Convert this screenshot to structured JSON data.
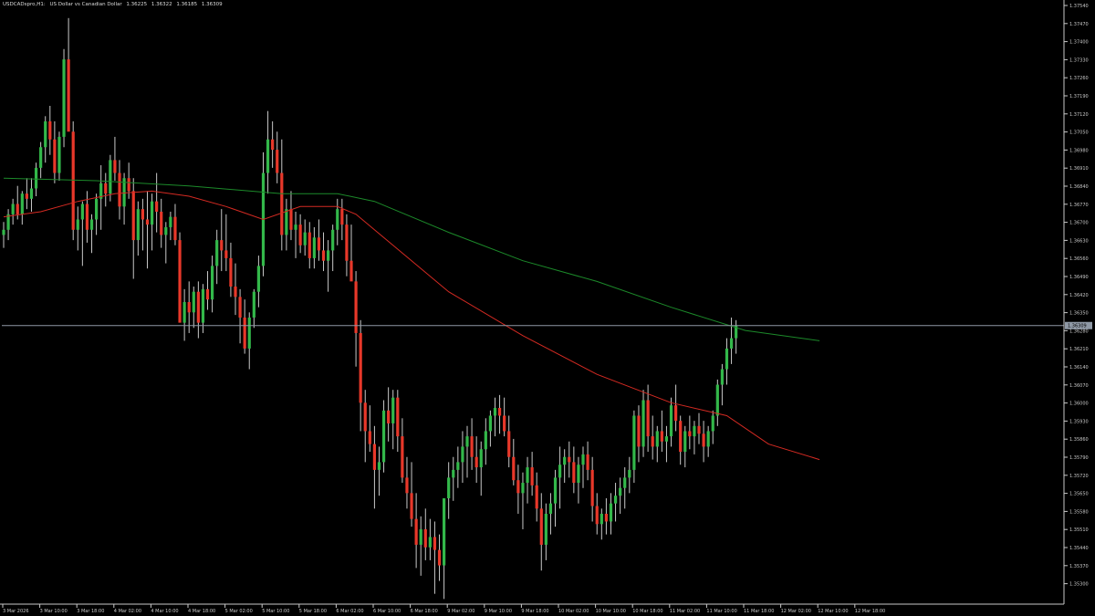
{
  "header": {
    "symbol": "USDCADspro,H1:",
    "description": "US Dollar vs Canadian Dollar",
    "ohlc": [
      "1.36225",
      "1.36322",
      "1.36185",
      "1.36309"
    ]
  },
  "colors": {
    "background": "#000000",
    "bull_candle": "#33b84a",
    "bear_candle": "#e8382a",
    "wick": "#c8c8c8",
    "ma_fast": "#d42a22",
    "ma_slow": "#1c8a2a",
    "price_line": "#8f99a6",
    "axis": "#c8c8c8"
  },
  "current_price": {
    "label": "1.36309",
    "value": 1.36309
  },
  "chart_data": {
    "type": "candlestick",
    "title": "USDCADspro,H1: US Dollar vs Canadian Dollar",
    "ylim": [
      1.3523,
      1.3757
    ],
    "y_ticks": [
      "1.37540",
      "1.37470",
      "1.37400",
      "1.37330",
      "1.37260",
      "1.37190",
      "1.37120",
      "1.37050",
      "1.36980",
      "1.36910",
      "1.36840",
      "1.36770",
      "1.36700",
      "1.36630",
      "1.36560",
      "1.36490",
      "1.36420",
      "1.36350",
      "1.36280",
      "1.36210",
      "1.36140",
      "1.36070",
      "1.36000",
      "1.35930",
      "1.35860",
      "1.35790",
      "1.35720",
      "1.35650",
      "1.35580",
      "1.35510",
      "1.35440",
      "1.35370",
      "1.35300"
    ],
    "x_ticks": [
      "3 Mar 2026",
      "3 Mar 10:00",
      "3 Mar 18:00",
      "4 Mar 02:00",
      "4 Mar 10:00",
      "4 Mar 18:00",
      "5 Mar 02:00",
      "5 Mar 10:00",
      "5 Mar 18:00",
      "6 Mar 02:00",
      "6 Mar 10:00",
      "6 Mar 18:00",
      "9 Mar 02:00",
      "9 Mar 10:00",
      "9 Mar 18:00",
      "10 Mar 02:00",
      "10 Mar 10:00",
      "10 Mar 18:00",
      "11 Mar 02:00",
      "11 Mar 10:00",
      "11 Mar 18:00",
      "12 Mar 02:00",
      "12 Mar 10:00",
      "12 Mar 18:00"
    ],
    "candles": [
      [
        1.3666,
        1.3671,
        1.3661,
        1.3668
      ],
      [
        1.3668,
        1.3676,
        1.3664,
        1.3674
      ],
      [
        1.3674,
        1.368,
        1.367,
        1.3678
      ],
      [
        1.3678,
        1.3685,
        1.3672,
        1.3674
      ],
      [
        1.3674,
        1.3683,
        1.367,
        1.3682
      ],
      [
        1.3682,
        1.3688,
        1.3676,
        1.368
      ],
      [
        1.368,
        1.3688,
        1.3675,
        1.3684
      ],
      [
        1.3684,
        1.3694,
        1.3681,
        1.3692
      ],
      [
        1.3692,
        1.3702,
        1.3688,
        1.37
      ],
      [
        1.37,
        1.3712,
        1.3694,
        1.371
      ],
      [
        1.371,
        1.3716,
        1.3697,
        1.3703
      ],
      [
        1.3703,
        1.371,
        1.3686,
        1.369
      ],
      [
        1.369,
        1.3706,
        1.3687,
        1.3704
      ],
      [
        1.3704,
        1.3738,
        1.37,
        1.3734
      ],
      [
        1.3734,
        1.375,
        1.3712,
        1.3706
      ],
      [
        1.3706,
        1.371,
        1.3664,
        1.3668
      ],
      [
        1.3668,
        1.3677,
        1.366,
        1.3672
      ],
      [
        1.3672,
        1.3679,
        1.3654,
        1.3678
      ],
      [
        1.3678,
        1.3683,
        1.3663,
        1.3668
      ],
      [
        1.3668,
        1.3674,
        1.3659,
        1.3672
      ],
      [
        1.3672,
        1.3682,
        1.3666,
        1.368
      ],
      [
        1.368,
        1.3693,
        1.3668,
        1.3686
      ],
      [
        1.3686,
        1.369,
        1.3677,
        1.3682
      ],
      [
        1.3682,
        1.3697,
        1.3679,
        1.3695
      ],
      [
        1.3695,
        1.3704,
        1.3687,
        1.369
      ],
      [
        1.369,
        1.3695,
        1.3672,
        1.3677
      ],
      [
        1.3677,
        1.369,
        1.367,
        1.3688
      ],
      [
        1.3688,
        1.3694,
        1.368,
        1.3683
      ],
      [
        1.3683,
        1.3688,
        1.3649,
        1.3664
      ],
      [
        1.3664,
        1.3679,
        1.3658,
        1.3676
      ],
      [
        1.3676,
        1.368,
        1.366,
        1.3672
      ],
      [
        1.3672,
        1.3683,
        1.3653,
        1.367
      ],
      [
        1.367,
        1.3682,
        1.366,
        1.3679
      ],
      [
        1.3679,
        1.369,
        1.3667,
        1.3675
      ],
      [
        1.3675,
        1.368,
        1.3661,
        1.3666
      ],
      [
        1.3666,
        1.3671,
        1.3655,
        1.3669
      ],
      [
        1.3669,
        1.3675,
        1.3664,
        1.3673
      ],
      [
        1.3673,
        1.3678,
        1.3662,
        1.3664
      ],
      [
        1.3664,
        1.3667,
        1.3643,
        1.3632
      ],
      [
        1.3632,
        1.3645,
        1.3625,
        1.364
      ],
      [
        1.364,
        1.3648,
        1.3628,
        1.3636
      ],
      [
        1.3636,
        1.3646,
        1.363,
        1.3644
      ],
      [
        1.3644,
        1.3648,
        1.3626,
        1.3632
      ],
      [
        1.3632,
        1.3647,
        1.3628,
        1.3645
      ],
      [
        1.3645,
        1.3652,
        1.3637,
        1.3641
      ],
      [
        1.3641,
        1.3658,
        1.3636,
        1.3654
      ],
      [
        1.3654,
        1.3668,
        1.3647,
        1.3664
      ],
      [
        1.3664,
        1.3676,
        1.3652,
        1.366
      ],
      [
        1.366,
        1.3674,
        1.3652,
        1.3657
      ],
      [
        1.3657,
        1.3663,
        1.3642,
        1.3646
      ],
      [
        1.3646,
        1.3655,
        1.3635,
        1.3642
      ],
      [
        1.3642,
        1.3645,
        1.3624,
        1.3634
      ],
      [
        1.3634,
        1.3641,
        1.362,
        1.3622
      ],
      [
        1.3622,
        1.3636,
        1.3614,
        1.3634
      ],
      [
        1.3634,
        1.3645,
        1.363,
        1.3644
      ],
      [
        1.3644,
        1.3658,
        1.3638,
        1.3654
      ],
      [
        1.3654,
        1.3698,
        1.365,
        1.369
      ],
      [
        1.369,
        1.3714,
        1.3682,
        1.3703
      ],
      [
        1.3703,
        1.371,
        1.3692,
        1.3699
      ],
      [
        1.3699,
        1.3706,
        1.3686,
        1.369
      ],
      [
        1.369,
        1.3703,
        1.366,
        1.3666
      ],
      [
        1.3666,
        1.368,
        1.366,
        1.3676
      ],
      [
        1.3676,
        1.3683,
        1.3664,
        1.3668
      ],
      [
        1.3668,
        1.3675,
        1.3657,
        1.367
      ],
      [
        1.367,
        1.3674,
        1.3659,
        1.3662
      ],
      [
        1.3662,
        1.3672,
        1.3658,
        1.3667
      ],
      [
        1.3667,
        1.3671,
        1.3653,
        1.3657
      ],
      [
        1.3657,
        1.3669,
        1.3653,
        1.3665
      ],
      [
        1.3665,
        1.3672,
        1.3656,
        1.366
      ],
      [
        1.366,
        1.3667,
        1.3652,
        1.3656
      ],
      [
        1.3656,
        1.3664,
        1.3644,
        1.366
      ],
      [
        1.366,
        1.367,
        1.3652,
        1.3668
      ],
      [
        1.3668,
        1.368,
        1.3662,
        1.3676
      ],
      [
        1.3676,
        1.368,
        1.3664,
        1.367
      ],
      [
        1.367,
        1.3674,
        1.365,
        1.3656
      ],
      [
        1.3656,
        1.367,
        1.3649,
        1.3648
      ],
      [
        1.3648,
        1.3652,
        1.3615,
        1.3628
      ],
      [
        1.3628,
        1.3633,
        1.359,
        1.3601
      ],
      [
        1.3601,
        1.3606,
        1.3578,
        1.359
      ],
      [
        1.359,
        1.36,
        1.3582,
        1.3585
      ],
      [
        1.3585,
        1.3592,
        1.356,
        1.3575
      ],
      [
        1.3575,
        1.3584,
        1.3565,
        1.3578
      ],
      [
        1.3578,
        1.3602,
        1.3574,
        1.3598
      ],
      [
        1.3598,
        1.3607,
        1.3586,
        1.3593
      ],
      [
        1.3593,
        1.3606,
        1.3583,
        1.3603
      ],
      [
        1.3603,
        1.3606,
        1.3582,
        1.3588
      ],
      [
        1.3588,
        1.3595,
        1.357,
        1.3572
      ],
      [
        1.3572,
        1.358,
        1.356,
        1.3566
      ],
      [
        1.3566,
        1.3578,
        1.3553,
        1.3556
      ],
      [
        1.3556,
        1.3566,
        1.3537,
        1.3546
      ],
      [
        1.3546,
        1.3557,
        1.3534,
        1.3552
      ],
      [
        1.3552,
        1.356,
        1.354,
        1.3545
      ],
      [
        1.3545,
        1.3556,
        1.354,
        1.3549
      ],
      [
        1.3549,
        1.3555,
        1.3527,
        1.3544
      ],
      [
        1.3544,
        1.355,
        1.3532,
        1.3538
      ],
      [
        1.3538,
        1.356,
        1.3525,
        1.3564
      ],
      [
        1.3564,
        1.3578,
        1.3556,
        1.3572
      ],
      [
        1.3572,
        1.358,
        1.3563,
        1.3575
      ],
      [
        1.3575,
        1.3584,
        1.3568,
        1.3578
      ],
      [
        1.3578,
        1.359,
        1.357,
        1.3584
      ],
      [
        1.3584,
        1.3592,
        1.3572,
        1.3588
      ],
      [
        1.3588,
        1.3595,
        1.3575,
        1.358
      ],
      [
        1.358,
        1.3588,
        1.357,
        1.3576
      ],
      [
        1.3576,
        1.3586,
        1.3565,
        1.3583
      ],
      [
        1.3583,
        1.3595,
        1.3577,
        1.359
      ],
      [
        1.359,
        1.3598,
        1.3584,
        1.3596
      ],
      [
        1.3596,
        1.3603,
        1.3588,
        1.3599
      ],
      [
        1.3599,
        1.3604,
        1.3589,
        1.3596
      ],
      [
        1.3596,
        1.3603,
        1.3588,
        1.359
      ],
      [
        1.359,
        1.3596,
        1.3576,
        1.358
      ],
      [
        1.358,
        1.3587,
        1.3569,
        1.3571
      ],
      [
        1.3571,
        1.3577,
        1.3558,
        1.3566
      ],
      [
        1.3566,
        1.3574,
        1.3552,
        1.357
      ],
      [
        1.357,
        1.358,
        1.3562,
        1.3576
      ],
      [
        1.3576,
        1.3582,
        1.3565,
        1.3569
      ],
      [
        1.3569,
        1.3574,
        1.3555,
        1.356
      ],
      [
        1.356,
        1.3566,
        1.3536,
        1.3546
      ],
      [
        1.3546,
        1.3562,
        1.354,
        1.3558
      ],
      [
        1.3558,
        1.3566,
        1.355,
        1.3562
      ],
      [
        1.3562,
        1.3575,
        1.3553,
        1.3572
      ],
      [
        1.3572,
        1.3584,
        1.356,
        1.3577
      ],
      [
        1.3577,
        1.3583,
        1.357,
        1.358
      ],
      [
        1.358,
        1.3586,
        1.3572,
        1.3578
      ],
      [
        1.3578,
        1.3584,
        1.3566,
        1.357
      ],
      [
        1.357,
        1.358,
        1.3562,
        1.3577
      ],
      [
        1.3577,
        1.3584,
        1.3568,
        1.3581
      ],
      [
        1.3581,
        1.3586,
        1.3571,
        1.3575
      ],
      [
        1.3575,
        1.358,
        1.3555,
        1.3561
      ],
      [
        1.3561,
        1.3566,
        1.355,
        1.3554
      ],
      [
        1.3554,
        1.356,
        1.3548,
        1.3558
      ],
      [
        1.3558,
        1.3564,
        1.355,
        1.3555
      ],
      [
        1.3555,
        1.3566,
        1.355,
        1.3562
      ],
      [
        1.3562,
        1.357,
        1.3555,
        1.3565
      ],
      [
        1.3565,
        1.3572,
        1.3558,
        1.3568
      ],
      [
        1.3568,
        1.3576,
        1.356,
        1.3572
      ],
      [
        1.3572,
        1.358,
        1.3566,
        1.3575
      ],
      [
        1.3575,
        1.3598,
        1.357,
        1.3596
      ],
      [
        1.3596,
        1.36,
        1.3578,
        1.3584
      ],
      [
        1.3584,
        1.3606,
        1.358,
        1.3602
      ],
      [
        1.3602,
        1.3608,
        1.3582,
        1.3588
      ],
      [
        1.3588,
        1.3596,
        1.3579,
        1.3584
      ],
      [
        1.3584,
        1.3592,
        1.3578,
        1.359
      ],
      [
        1.359,
        1.3598,
        1.3582,
        1.3586
      ],
      [
        1.3586,
        1.3592,
        1.3578,
        1.3588
      ],
      [
        1.3588,
        1.3603,
        1.3584,
        1.36
      ],
      [
        1.36,
        1.3608,
        1.359,
        1.3594
      ],
      [
        1.3594,
        1.3596,
        1.3577,
        1.3582
      ],
      [
        1.3582,
        1.3592,
        1.3576,
        1.359
      ],
      [
        1.359,
        1.3596,
        1.3583,
        1.3588
      ],
      [
        1.3588,
        1.3594,
        1.3581,
        1.3592
      ],
      [
        1.3592,
        1.3597,
        1.3585,
        1.3589
      ],
      [
        1.3589,
        1.3594,
        1.3578,
        1.3584
      ],
      [
        1.3584,
        1.3592,
        1.358,
        1.359
      ],
      [
        1.359,
        1.3598,
        1.3585,
        1.3596
      ],
      [
        1.3596,
        1.361,
        1.3592,
        1.3608
      ],
      [
        1.3608,
        1.3616,
        1.36,
        1.3614
      ],
      [
        1.3614,
        1.3626,
        1.3608,
        1.3622
      ],
      [
        1.3622,
        1.3634,
        1.3616,
        1.3626
      ],
      [
        1.3626,
        1.3633,
        1.362,
        1.3631
      ]
    ],
    "ma_fast": [
      [
        0,
        1.3673
      ],
      [
        8,
        1.3675
      ],
      [
        16,
        1.3679
      ],
      [
        24,
        1.3682
      ],
      [
        32,
        1.3683
      ],
      [
        40,
        1.3681
      ],
      [
        48,
        1.3677
      ],
      [
        56,
        1.3672
      ],
      [
        64,
        1.3677
      ],
      [
        72,
        1.3677
      ],
      [
        76,
        1.3674
      ],
      [
        84,
        1.3662
      ],
      [
        96,
        1.3644
      ],
      [
        112,
        1.3627
      ],
      [
        128,
        1.3612
      ],
      [
        144,
        1.3601
      ],
      [
        156,
        1.3596
      ],
      [
        165,
        1.3585
      ],
      [
        176,
        1.3579
      ]
    ],
    "ma_slow": [
      [
        0,
        1.3688
      ],
      [
        20,
        1.3687
      ],
      [
        40,
        1.3685
      ],
      [
        60,
        1.3682
      ],
      [
        72,
        1.3682
      ],
      [
        80,
        1.3679
      ],
      [
        96,
        1.3667
      ],
      [
        112,
        1.3656
      ],
      [
        128,
        1.3648
      ],
      [
        144,
        1.3638
      ],
      [
        160,
        1.3629
      ],
      [
        176,
        1.3625
      ]
    ]
  }
}
